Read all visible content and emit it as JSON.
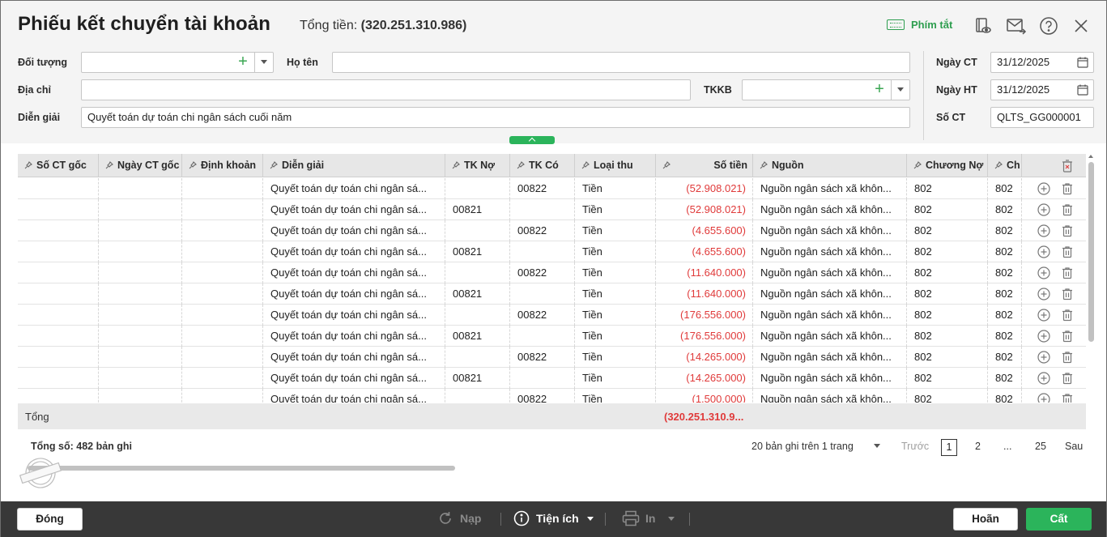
{
  "header": {
    "title": "Phiếu kết chuyển tài khoản",
    "total_label": "Tổng tiền: ",
    "total_value": "(320.251.310.986)",
    "hotkeys_label": "Phím tắt"
  },
  "form": {
    "doi_tuong_label": "Đối tượng",
    "doi_tuong_value": "",
    "ho_ten_label": "Họ tên",
    "ho_ten_value": "",
    "dia_chi_label": "Địa chỉ",
    "dia_chi_value": "",
    "tkkb_label": "TKKB",
    "tkkb_value": "",
    "dien_giai_label": "Diễn giải",
    "dien_giai_value": "Quyết toán dự toán chi ngân sách cuối năm",
    "ngay_ct_label": "Ngày CT",
    "ngay_ct_value": "31/12/2025",
    "ngay_ht_label": "Ngày HT",
    "ngay_ht_value": "31/12/2025",
    "so_ct_label": "Số CT",
    "so_ct_value": "QLTS_GG000001"
  },
  "grid": {
    "columns": [
      "Số CT gốc",
      "Ngày CT gốc",
      "Định khoản",
      "Diễn giải",
      "TK Nợ",
      "TK Có",
      "Loại thu",
      "Số tiền",
      "Nguồn",
      "Chương Nợ",
      "Ch"
    ],
    "rows": [
      {
        "dien_giai": "Quyết toán dự toán chi ngân sá...",
        "tk_no": "",
        "tk_co": "00822",
        "loai_thu": "Tiền",
        "so_tien": "(52.908.021)",
        "nguon": "Nguồn ngân sách xã khôn...",
        "chuong_no": "802",
        "ch": "802"
      },
      {
        "dien_giai": "Quyết toán dự toán chi ngân sá...",
        "tk_no": "00821",
        "tk_co": "",
        "loai_thu": "Tiền",
        "so_tien": "(52.908.021)",
        "nguon": "Nguồn ngân sách xã khôn...",
        "chuong_no": "802",
        "ch": "802"
      },
      {
        "dien_giai": "Quyết toán dự toán chi ngân sá...",
        "tk_no": "",
        "tk_co": "00822",
        "loai_thu": "Tiền",
        "so_tien": "(4.655.600)",
        "nguon": "Nguồn ngân sách xã khôn...",
        "chuong_no": "802",
        "ch": "802"
      },
      {
        "dien_giai": "Quyết toán dự toán chi ngân sá...",
        "tk_no": "00821",
        "tk_co": "",
        "loai_thu": "Tiền",
        "so_tien": "(4.655.600)",
        "nguon": "Nguồn ngân sách xã khôn...",
        "chuong_no": "802",
        "ch": "802"
      },
      {
        "dien_giai": "Quyết toán dự toán chi ngân sá...",
        "tk_no": "",
        "tk_co": "00822",
        "loai_thu": "Tiền",
        "so_tien": "(11.640.000)",
        "nguon": "Nguồn ngân sách xã khôn...",
        "chuong_no": "802",
        "ch": "802"
      },
      {
        "dien_giai": "Quyết toán dự toán chi ngân sá...",
        "tk_no": "00821",
        "tk_co": "",
        "loai_thu": "Tiền",
        "so_tien": "(11.640.000)",
        "nguon": "Nguồn ngân sách xã khôn...",
        "chuong_no": "802",
        "ch": "802"
      },
      {
        "dien_giai": "Quyết toán dự toán chi ngân sá...",
        "tk_no": "",
        "tk_co": "00822",
        "loai_thu": "Tiền",
        "so_tien": "(176.556.000)",
        "nguon": "Nguồn ngân sách xã khôn...",
        "chuong_no": "802",
        "ch": "802"
      },
      {
        "dien_giai": "Quyết toán dự toán chi ngân sá...",
        "tk_no": "00821",
        "tk_co": "",
        "loai_thu": "Tiền",
        "so_tien": "(176.556.000)",
        "nguon": "Nguồn ngân sách xã khôn...",
        "chuong_no": "802",
        "ch": "802"
      },
      {
        "dien_giai": "Quyết toán dự toán chi ngân sá...",
        "tk_no": "",
        "tk_co": "00822",
        "loai_thu": "Tiền",
        "so_tien": "(14.265.000)",
        "nguon": "Nguồn ngân sách xã khôn...",
        "chuong_no": "802",
        "ch": "802"
      },
      {
        "dien_giai": "Quyết toán dự toán chi ngân sá...",
        "tk_no": "00821",
        "tk_co": "",
        "loai_thu": "Tiền",
        "so_tien": "(14.265.000)",
        "nguon": "Nguồn ngân sách xã khôn...",
        "chuong_no": "802",
        "ch": "802"
      },
      {
        "dien_giai": "Quyết toán dự toán chi ngân sá...",
        "tk_no": "",
        "tk_co": "00822",
        "loai_thu": "Tiền",
        "so_tien": "(1.500.000)",
        "nguon": "Nguồn ngân sách xã khôn...",
        "chuong_no": "802",
        "ch": "802"
      }
    ],
    "sum_label": "Tổng",
    "sum_value": "(320.251.310.9..."
  },
  "pagination": {
    "record_count": "Tổng số: 482 bản ghi",
    "page_size": "20 bản ghi trên 1 trang",
    "prev": "Trước",
    "current": "1",
    "page2": "2",
    "ellipsis": "...",
    "last": "25",
    "next": "Sau"
  },
  "footer": {
    "close": "Đóng",
    "reload": "Nạp",
    "utilities": "Tiện ích",
    "print": "In",
    "cancel": "Hoãn",
    "save": "Cất"
  },
  "colors": {
    "accent_green": "#2bb45b",
    "negative_red": "#e03a3a",
    "footer_bg": "#383838"
  },
  "icons": [
    "keyboard-icon",
    "eye-book-icon",
    "mail-icon",
    "help-icon",
    "close-icon",
    "calendar-icon",
    "pin-icon",
    "add-row-icon",
    "delete-row-icon",
    "clear-all-icon",
    "reload-icon",
    "info-icon",
    "printer-icon"
  ]
}
